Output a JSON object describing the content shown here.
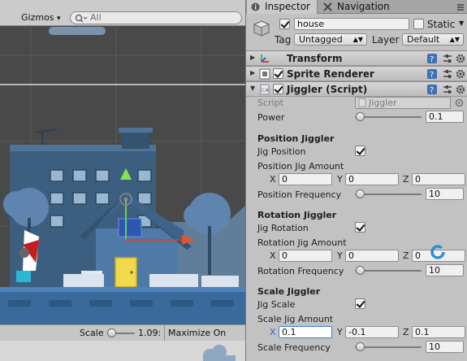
{
  "scene_view": {
    "toolbar": {
      "gizmos_label": "Gizmos",
      "gizmos_arrow": "▾",
      "search_placeholder": "All"
    },
    "status": {
      "scale_label": "Scale",
      "scale_value": "1.09:",
      "maximize_label": "Maximize On Play"
    }
  },
  "inspector": {
    "tabs": [
      {
        "label": "Inspector",
        "icon": "info-icon"
      },
      {
        "label": "Navigation",
        "icon": "navigation-icon"
      }
    ],
    "object": {
      "name": "house",
      "active": true,
      "static_label": "Static",
      "static_checked": false,
      "tag_label": "Tag",
      "tag_value": "Untagged",
      "layer_label": "Layer",
      "layer_value": "Default"
    },
    "components": [
      {
        "name": "Transform",
        "icon": "transform-icon"
      },
      {
        "name": "Sprite Renderer",
        "icon": "sprite-renderer-icon",
        "enabled": true
      },
      {
        "name": "Jiggler (Script)",
        "icon": "script-icon",
        "enabled": true
      }
    ],
    "jiggler": {
      "script_label": "Script",
      "script_value": "Jiggler",
      "power_label": "Power",
      "power_value": "0.1",
      "power_fraction": 0.02,
      "position": {
        "header": "Position Jiggler",
        "jig_label": "Jig Position",
        "jig_checked": true,
        "amount_label": "Position Jig Amount",
        "x": "0",
        "y": "0",
        "z": "0",
        "freq_label": "Position Frequency",
        "freq_value": "10",
        "freq_fraction": 0.02
      },
      "rotation": {
        "header": "Rotation Jiggler",
        "jig_label": "Jig Rotation",
        "jig_checked": true,
        "amount_label": "Rotation Jig Amount",
        "x": "0",
        "y": "0",
        "z": "0",
        "freq_label": "Rotation Frequency",
        "freq_value": "10",
        "freq_fraction": 0.02
      },
      "scale": {
        "header": "Scale Jiggler",
        "jig_label": "Jig Scale",
        "jig_checked": true,
        "amount_label": "Scale Jig Amount",
        "x": "0.1",
        "y": "-0.1",
        "z": "0.1",
        "freq_label": "Scale Frequency",
        "freq_value": "10",
        "freq_fraction": 0.02
      }
    },
    "axis_labels": {
      "x": "X",
      "y": "Y",
      "z": "Z"
    }
  },
  "colors": {
    "selection_outline": "#3a7bd5",
    "busy_spinner": "#2d8fd6",
    "scene_background": "#494949",
    "building": "#3c5f80"
  }
}
